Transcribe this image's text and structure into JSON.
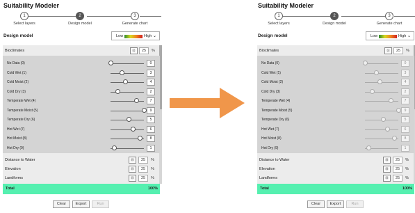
{
  "app_title": "Suitability Modeler",
  "steps": [
    {
      "number": "1",
      "label": "Select layers"
    },
    {
      "number": "2",
      "label": "Design model"
    },
    {
      "number": "3",
      "label": "Generate chart"
    }
  ],
  "design": {
    "title": "Design model",
    "legend_low": "Low",
    "legend_high": "High"
  },
  "criteria": {
    "bioclimates": {
      "label": "Bioclimates",
      "value": "25",
      "unit": "%",
      "lock_icon": "lock-icon"
    },
    "distance_to_water": {
      "label": "Distance to Water",
      "value": "25",
      "unit": "%"
    },
    "elevation": {
      "label": "Elevation",
      "value": "25",
      "unit": "%"
    },
    "landforms": {
      "label": "Landforms",
      "value": "25",
      "unit": "%"
    }
  },
  "subcriteria": [
    {
      "label": "No Data (0)",
      "value": "0",
      "max": 9
    },
    {
      "label": "Cold Wet (1)",
      "value": "3",
      "max": 9
    },
    {
      "label": "Cold Moist (2)",
      "value": "4",
      "max": 9
    },
    {
      "label": "Cold Dry (3)",
      "value": "2",
      "max": 9
    },
    {
      "label": "Temperate Wet (4)",
      "value": "7",
      "max": 9
    },
    {
      "label": "Temperate Moist (5)",
      "value": "9",
      "max": 9
    },
    {
      "label": "Temperate Dry (6)",
      "value": "5",
      "max": 9
    },
    {
      "label": "Hot Wet (7)",
      "value": "6",
      "max": 9
    },
    {
      "label": "Hot Moist (8)",
      "value": "8",
      "max": 9
    },
    {
      "label": "Hot Dry (9)",
      "value": "1",
      "max": 9
    }
  ],
  "total": {
    "label": "Total",
    "value": "100%"
  },
  "buttons": {
    "clear": "Clear",
    "export": "Export",
    "run": "Run"
  },
  "colors": {
    "total_bar": "#55f0b0",
    "arrow": "#f0964a"
  }
}
